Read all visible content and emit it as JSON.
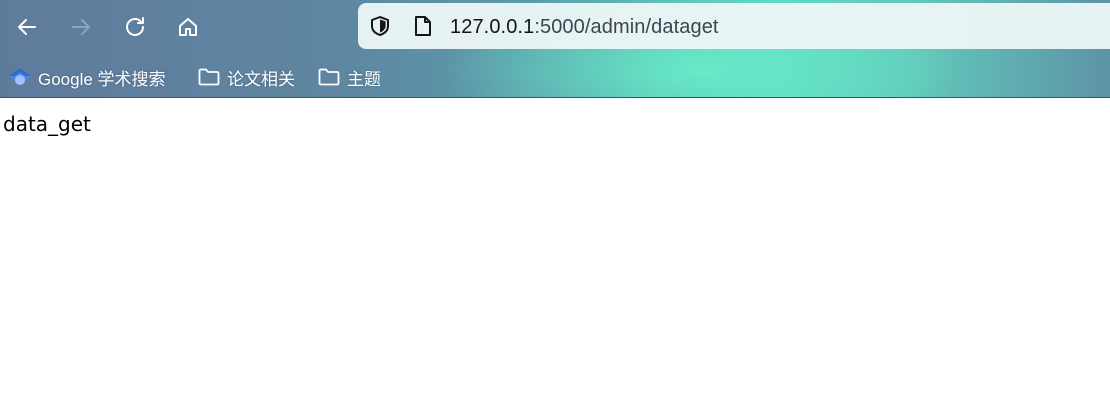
{
  "toolbar": {
    "back_icon": "arrow-left-icon",
    "forward_icon": "arrow-right-icon",
    "reload_icon": "reload-icon",
    "home_icon": "home-icon"
  },
  "url_bar": {
    "host": "127.0.0.1",
    "path": ":5000/admin/dataget",
    "security_icon": "shield-icon",
    "page_icon": "page-icon"
  },
  "bookmarks": {
    "items": [
      {
        "label": "Google 学术搜索",
        "icon": "google-scholar-icon"
      },
      {
        "label": "论文相关",
        "icon": "folder-icon"
      },
      {
        "label": "主题",
        "icon": "folder-icon"
      }
    ]
  },
  "page": {
    "body_text": "data_get"
  },
  "colors": {
    "chrome_base": "#5f7b9c",
    "chrome_accent": "#68ecc8",
    "url_bar_bg": "#ecf6f6",
    "forward_disabled": "#8ea5b8"
  }
}
